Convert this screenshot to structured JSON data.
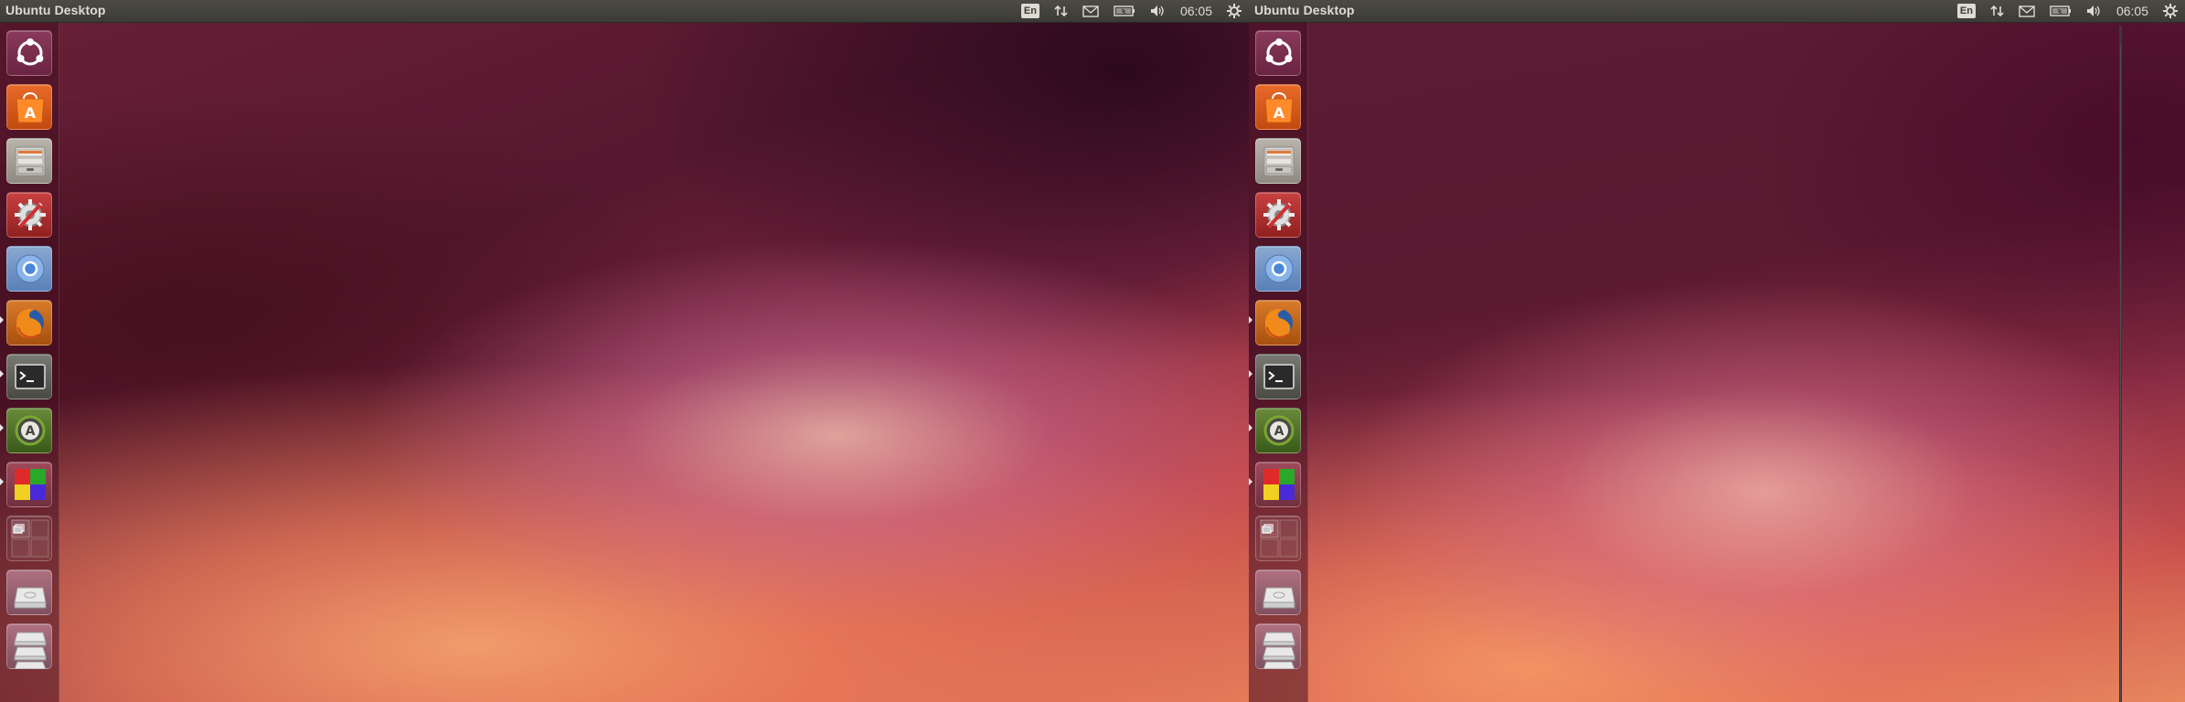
{
  "panel": {
    "title": "Ubuntu Desktop",
    "keyboard_layout": "En",
    "clock": "06:05"
  },
  "icons": {
    "dash": "ubuntu-logo-icon",
    "software_center": "ubuntu-software-center-icon",
    "files": "file-cabinet-icon",
    "settings": "system-settings-icon",
    "chromium": "chromium-icon",
    "firefox": "firefox-icon",
    "terminal": "terminal-icon",
    "updater": "software-updater-icon",
    "color_app": "color-blocks-icon",
    "workspaces": "workspace-switcher-icon",
    "drive": "hard-drive-icon",
    "drives_stack": "removable-drives-icon"
  },
  "colors": {
    "panel_bg": "#3c3b37",
    "launcher_bg": "#460e20",
    "panel_text": "#dfdbd2"
  }
}
